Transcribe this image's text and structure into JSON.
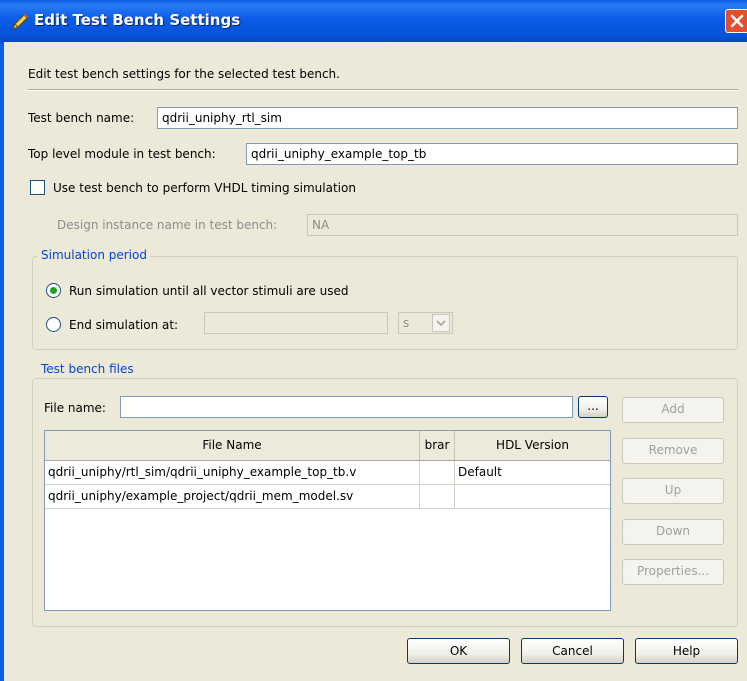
{
  "window": {
    "title": "Edit Test Bench Settings"
  },
  "description": "Edit test bench settings for the selected test bench.",
  "test_bench_name": {
    "label": "Test bench name:",
    "value": "qdrii_uniphy_rtl_sim"
  },
  "top_level_module": {
    "label": "Top level module in test bench:",
    "value": "qdrii_uniphy_example_top_tb"
  },
  "use_vhdl_timing": {
    "label": "Use test bench to perform VHDL timing simulation",
    "checked": false
  },
  "design_instance": {
    "label": "Design instance name in test bench:",
    "value": "NA"
  },
  "simulation_period": {
    "title": "Simulation period",
    "run_until_label": "Run simulation until all vector stimuli are used",
    "end_at_label": "End simulation at:",
    "end_at_value": "",
    "unit": "s",
    "selected": "run_until"
  },
  "test_bench_files": {
    "title": "Test bench files",
    "file_name_label": "File name:",
    "file_name_value": "",
    "browse_label": "...",
    "columns": [
      "File Name",
      "brar",
      "HDL Version"
    ],
    "rows": [
      {
        "file": "qdrii_uniphy/rtl_sim/qdrii_uniphy_example_top_tb.v",
        "library": "",
        "hdl": "Default"
      },
      {
        "file": "qdrii_uniphy/example_project/qdrii_mem_model.sv",
        "library": "",
        "hdl": ""
      }
    ],
    "buttons": {
      "add": "Add",
      "remove": "Remove",
      "up": "Up",
      "down": "Down",
      "properties": "Properties..."
    }
  },
  "footer": {
    "ok": "OK",
    "cancel": "Cancel",
    "help": "Help"
  },
  "colors": {
    "titlebar": "#0a5ee9",
    "group_title": "#0046d5",
    "radio_dot": "#21a121",
    "close": "#e44e2c"
  },
  "icons": {
    "title": "pencil-icon",
    "close": "close-icon",
    "combo": "chevron-down-icon"
  }
}
